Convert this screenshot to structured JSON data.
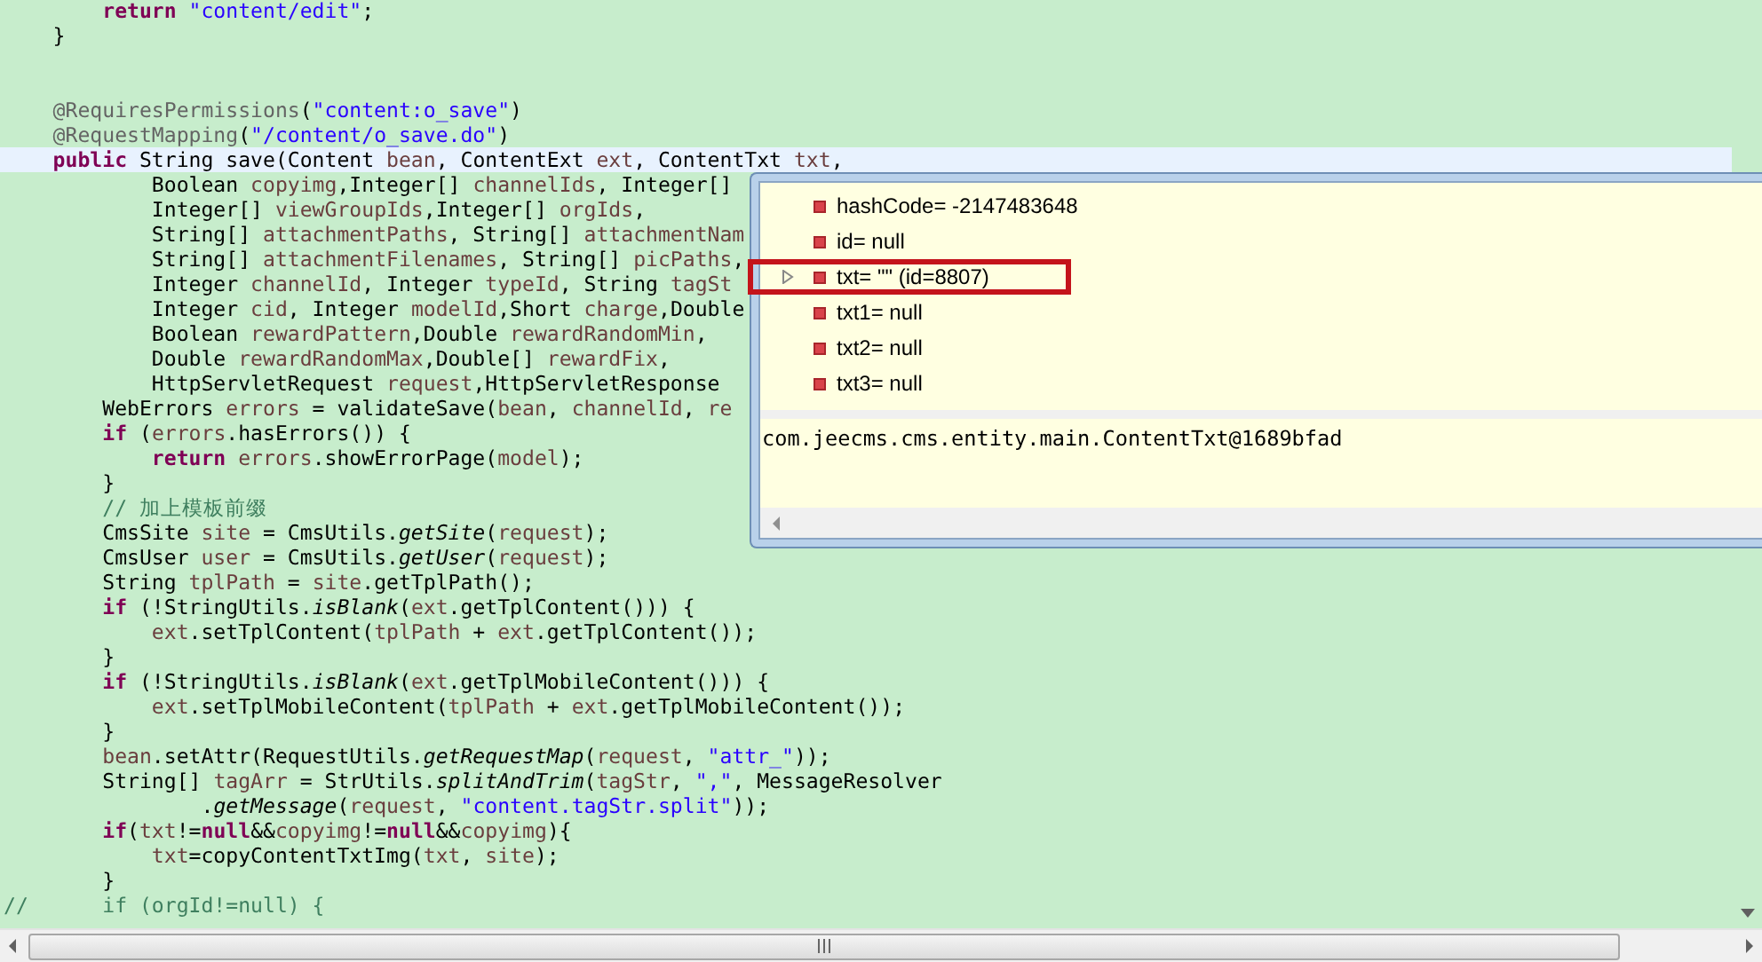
{
  "editor": {
    "lines": [
      {
        "kind": "code",
        "highlighted": false,
        "segments": [
          {
            "kind": "keyword",
            "text": "        return"
          },
          {
            "kind": "string",
            "text": " \"content/edit\""
          },
          {
            "kind": "plain",
            "text": ";"
          }
        ]
      },
      {
        "kind": "code",
        "highlighted": false,
        "segments": [
          {
            "kind": "plain",
            "text": "    }"
          }
        ]
      },
      {
        "kind": "blank",
        "highlighted": false
      },
      {
        "kind": "blank",
        "highlighted": false
      },
      {
        "kind": "code",
        "highlighted": false,
        "segments": [
          {
            "kind": "annotation",
            "text": "    @RequiresPermissions"
          },
          {
            "kind": "plain",
            "text": "("
          },
          {
            "kind": "string",
            "text": "\"content:o_save\""
          },
          {
            "kind": "plain",
            "text": ")"
          }
        ]
      },
      {
        "kind": "code",
        "highlighted": false,
        "segments": [
          {
            "kind": "annotation",
            "text": "    @RequestMapping"
          },
          {
            "kind": "plain",
            "text": "("
          },
          {
            "kind": "string",
            "text": "\"/content/o_save.do\""
          },
          {
            "kind": "plain",
            "text": ")"
          }
        ]
      },
      {
        "kind": "code",
        "highlighted": true,
        "segments": [
          {
            "kind": "keyword",
            "text": "    public"
          },
          {
            "kind": "plain",
            "text": " String save(Content "
          },
          {
            "kind": "variable",
            "text": "bean"
          },
          {
            "kind": "plain",
            "text": ", ContentExt "
          },
          {
            "kind": "variable",
            "text": "ext"
          },
          {
            "kind": "plain",
            "text": ", ContentTxt "
          },
          {
            "kind": "variable",
            "text": "txt"
          },
          {
            "kind": "plain",
            "text": ","
          }
        ]
      },
      {
        "kind": "code",
        "highlighted": false,
        "segments": [
          {
            "kind": "plain",
            "text": "            Boolean "
          },
          {
            "kind": "variable",
            "text": "copyimg"
          },
          {
            "kind": "plain",
            "text": ",Integer[] "
          },
          {
            "kind": "variable",
            "text": "channelIds"
          },
          {
            "kind": "plain",
            "text": ", Integer[]"
          }
        ]
      },
      {
        "kind": "code",
        "highlighted": false,
        "segments": [
          {
            "kind": "plain",
            "text": "            Integer[] "
          },
          {
            "kind": "variable",
            "text": "viewGroupIds"
          },
          {
            "kind": "plain",
            "text": ",Integer[] "
          },
          {
            "kind": "variable",
            "text": "orgIds"
          },
          {
            "kind": "plain",
            "text": ","
          }
        ]
      },
      {
        "kind": "code",
        "highlighted": false,
        "segments": [
          {
            "kind": "plain",
            "text": "            String[] "
          },
          {
            "kind": "variable",
            "text": "attachmentPaths"
          },
          {
            "kind": "plain",
            "text": ", String[] "
          },
          {
            "kind": "variable",
            "text": "attachmentNam"
          }
        ]
      },
      {
        "kind": "code",
        "highlighted": false,
        "segments": [
          {
            "kind": "plain",
            "text": "            String[] "
          },
          {
            "kind": "variable",
            "text": "attachmentFilenames"
          },
          {
            "kind": "plain",
            "text": ", String[] "
          },
          {
            "kind": "variable",
            "text": "picPaths"
          },
          {
            "kind": "plain",
            "text": ","
          }
        ]
      },
      {
        "kind": "code",
        "highlighted": false,
        "segments": [
          {
            "kind": "plain",
            "text": "            Integer "
          },
          {
            "kind": "variable",
            "text": "channelId"
          },
          {
            "kind": "plain",
            "text": ", Integer "
          },
          {
            "kind": "variable",
            "text": "typeId"
          },
          {
            "kind": "plain",
            "text": ", String "
          },
          {
            "kind": "variable",
            "text": "tagSt"
          }
        ]
      },
      {
        "kind": "code",
        "highlighted": false,
        "segments": [
          {
            "kind": "plain",
            "text": "            Integer "
          },
          {
            "kind": "variable",
            "text": "cid"
          },
          {
            "kind": "plain",
            "text": ", Integer "
          },
          {
            "kind": "variable",
            "text": "modelId"
          },
          {
            "kind": "plain",
            "text": ",Short "
          },
          {
            "kind": "variable",
            "text": "charge"
          },
          {
            "kind": "plain",
            "text": ",Double"
          }
        ]
      },
      {
        "kind": "code",
        "highlighted": false,
        "segments": [
          {
            "kind": "plain",
            "text": "            Boolean "
          },
          {
            "kind": "variable",
            "text": "rewardPattern"
          },
          {
            "kind": "plain",
            "text": ",Double "
          },
          {
            "kind": "variable",
            "text": "rewardRandomMin"
          },
          {
            "kind": "plain",
            "text": ","
          }
        ]
      },
      {
        "kind": "code",
        "highlighted": false,
        "segments": [
          {
            "kind": "plain",
            "text": "            Double "
          },
          {
            "kind": "variable",
            "text": "rewardRandomMax"
          },
          {
            "kind": "plain",
            "text": ",Double[] "
          },
          {
            "kind": "variable",
            "text": "rewardFix"
          },
          {
            "kind": "plain",
            "text": ","
          }
        ]
      },
      {
        "kind": "code",
        "highlighted": false,
        "segments": [
          {
            "kind": "plain",
            "text": "            HttpServletRequest "
          },
          {
            "kind": "variable",
            "text": "request"
          },
          {
            "kind": "plain",
            "text": ",HttpServletResponse"
          }
        ]
      },
      {
        "kind": "code",
        "highlighted": false,
        "segments": [
          {
            "kind": "plain",
            "text": "        WebErrors "
          },
          {
            "kind": "variable",
            "text": "errors"
          },
          {
            "kind": "plain",
            "text": " = validateSave("
          },
          {
            "kind": "variable",
            "text": "bean"
          },
          {
            "kind": "plain",
            "text": ", "
          },
          {
            "kind": "variable",
            "text": "channelId"
          },
          {
            "kind": "plain",
            "text": ", "
          },
          {
            "kind": "variable",
            "text": "re"
          }
        ]
      },
      {
        "kind": "code",
        "highlighted": false,
        "segments": [
          {
            "kind": "keyword",
            "text": "        if"
          },
          {
            "kind": "plain",
            "text": " ("
          },
          {
            "kind": "variable",
            "text": "errors"
          },
          {
            "kind": "plain",
            "text": ".hasErrors()) {"
          }
        ]
      },
      {
        "kind": "code",
        "highlighted": false,
        "segments": [
          {
            "kind": "keyword",
            "text": "            return"
          },
          {
            "kind": "variable",
            "text": " errors"
          },
          {
            "kind": "plain",
            "text": ".showErrorPage("
          },
          {
            "kind": "variable",
            "text": "model"
          },
          {
            "kind": "plain",
            "text": ");"
          }
        ]
      },
      {
        "kind": "code",
        "highlighted": false,
        "segments": [
          {
            "kind": "plain",
            "text": "        }"
          }
        ]
      },
      {
        "kind": "code",
        "highlighted": false,
        "segments": [
          {
            "kind": "comment",
            "text": "        // 加上模板前缀"
          }
        ]
      },
      {
        "kind": "code",
        "highlighted": false,
        "segments": [
          {
            "kind": "plain",
            "text": "        CmsSite "
          },
          {
            "kind": "variable",
            "text": "site"
          },
          {
            "kind": "plain",
            "text": " = CmsUtils."
          },
          {
            "kind": "static",
            "text": "getSite"
          },
          {
            "kind": "plain",
            "text": "("
          },
          {
            "kind": "variable",
            "text": "request"
          },
          {
            "kind": "plain",
            "text": ");"
          }
        ]
      },
      {
        "kind": "code",
        "highlighted": false,
        "segments": [
          {
            "kind": "plain",
            "text": "        CmsUser "
          },
          {
            "kind": "variable",
            "text": "user"
          },
          {
            "kind": "plain",
            "text": " = CmsUtils."
          },
          {
            "kind": "static",
            "text": "getUser"
          },
          {
            "kind": "plain",
            "text": "("
          },
          {
            "kind": "variable",
            "text": "request"
          },
          {
            "kind": "plain",
            "text": ");"
          }
        ]
      },
      {
        "kind": "code",
        "highlighted": false,
        "segments": [
          {
            "kind": "plain",
            "text": "        String "
          },
          {
            "kind": "variable",
            "text": "tplPath"
          },
          {
            "kind": "plain",
            "text": " = "
          },
          {
            "kind": "variable",
            "text": "site"
          },
          {
            "kind": "plain",
            "text": ".getTplPath();"
          }
        ]
      },
      {
        "kind": "code",
        "highlighted": false,
        "segments": [
          {
            "kind": "keyword",
            "text": "        if"
          },
          {
            "kind": "plain",
            "text": " (!StringUtils."
          },
          {
            "kind": "static",
            "text": "isBlank"
          },
          {
            "kind": "plain",
            "text": "("
          },
          {
            "kind": "variable",
            "text": "ext"
          },
          {
            "kind": "plain",
            "text": ".getTplContent())) {"
          }
        ]
      },
      {
        "kind": "code",
        "highlighted": false,
        "segments": [
          {
            "kind": "variable",
            "text": "            ext"
          },
          {
            "kind": "plain",
            "text": ".setTplContent("
          },
          {
            "kind": "variable",
            "text": "tplPath"
          },
          {
            "kind": "plain",
            "text": " + "
          },
          {
            "kind": "variable",
            "text": "ext"
          },
          {
            "kind": "plain",
            "text": ".getTplContent());"
          }
        ]
      },
      {
        "kind": "code",
        "highlighted": false,
        "segments": [
          {
            "kind": "plain",
            "text": "        }"
          }
        ]
      },
      {
        "kind": "code",
        "highlighted": false,
        "segments": [
          {
            "kind": "keyword",
            "text": "        if"
          },
          {
            "kind": "plain",
            "text": " (!StringUtils."
          },
          {
            "kind": "static",
            "text": "isBlank"
          },
          {
            "kind": "plain",
            "text": "("
          },
          {
            "kind": "variable",
            "text": "ext"
          },
          {
            "kind": "plain",
            "text": ".getTplMobileContent())) {"
          }
        ]
      },
      {
        "kind": "code",
        "highlighted": false,
        "segments": [
          {
            "kind": "variable",
            "text": "            ext"
          },
          {
            "kind": "plain",
            "text": ".setTplMobileContent("
          },
          {
            "kind": "variable",
            "text": "tplPath"
          },
          {
            "kind": "plain",
            "text": " + "
          },
          {
            "kind": "variable",
            "text": "ext"
          },
          {
            "kind": "plain",
            "text": ".getTplMobileContent());"
          }
        ]
      },
      {
        "kind": "code",
        "highlighted": false,
        "segments": [
          {
            "kind": "plain",
            "text": "        }"
          }
        ]
      },
      {
        "kind": "code",
        "highlighted": false,
        "segments": [
          {
            "kind": "variable",
            "text": "        bean"
          },
          {
            "kind": "plain",
            "text": ".setAttr(RequestUtils."
          },
          {
            "kind": "static",
            "text": "getRequestMap"
          },
          {
            "kind": "plain",
            "text": "("
          },
          {
            "kind": "variable",
            "text": "request"
          },
          {
            "kind": "plain",
            "text": ", "
          },
          {
            "kind": "string",
            "text": "\"attr_\""
          },
          {
            "kind": "plain",
            "text": "));"
          }
        ]
      },
      {
        "kind": "code",
        "highlighted": false,
        "segments": [
          {
            "kind": "plain",
            "text": "        String[] "
          },
          {
            "kind": "variable",
            "text": "tagArr"
          },
          {
            "kind": "plain",
            "text": " = StrUtils."
          },
          {
            "kind": "static",
            "text": "splitAndTrim"
          },
          {
            "kind": "plain",
            "text": "("
          },
          {
            "kind": "variable",
            "text": "tagStr"
          },
          {
            "kind": "plain",
            "text": ", "
          },
          {
            "kind": "string",
            "text": "\",\""
          },
          {
            "kind": "plain",
            "text": ", MessageResolver"
          }
        ]
      },
      {
        "kind": "code",
        "highlighted": false,
        "segments": [
          {
            "kind": "plain",
            "text": "                ."
          },
          {
            "kind": "static",
            "text": "getMessage"
          },
          {
            "kind": "plain",
            "text": "("
          },
          {
            "kind": "variable",
            "text": "request"
          },
          {
            "kind": "plain",
            "text": ", "
          },
          {
            "kind": "string",
            "text": "\"content.tagStr.split\""
          },
          {
            "kind": "plain",
            "text": "));"
          }
        ]
      },
      {
        "kind": "code",
        "highlighted": false,
        "segments": [
          {
            "kind": "keyword",
            "text": "        if"
          },
          {
            "kind": "plain",
            "text": "("
          },
          {
            "kind": "variable",
            "text": "txt"
          },
          {
            "kind": "plain",
            "text": "!="
          },
          {
            "kind": "keyword",
            "text": "null"
          },
          {
            "kind": "plain",
            "text": "&&"
          },
          {
            "kind": "variable",
            "text": "copyimg"
          },
          {
            "kind": "plain",
            "text": "!="
          },
          {
            "kind": "keyword",
            "text": "null"
          },
          {
            "kind": "plain",
            "text": "&&"
          },
          {
            "kind": "variable",
            "text": "copyimg"
          },
          {
            "kind": "plain",
            "text": "){"
          }
        ]
      },
      {
        "kind": "code",
        "highlighted": false,
        "segments": [
          {
            "kind": "variable",
            "text": "            txt"
          },
          {
            "kind": "plain",
            "text": "=copyContentTxtImg("
          },
          {
            "kind": "variable",
            "text": "txt"
          },
          {
            "kind": "plain",
            "text": ", "
          },
          {
            "kind": "variable",
            "text": "site"
          },
          {
            "kind": "plain",
            "text": ");"
          }
        ]
      },
      {
        "kind": "code",
        "highlighted": false,
        "segments": [
          {
            "kind": "plain",
            "text": "        }"
          }
        ]
      },
      {
        "kind": "code",
        "highlighted": false,
        "segments": [
          {
            "kind": "comment",
            "text": "//      if (orgId!=null) {"
          }
        ]
      }
    ]
  },
  "inspector": {
    "variables": [
      {
        "label": "hashCode= -2147483648",
        "expandable": false,
        "boxed": false
      },
      {
        "label": "id= null",
        "expandable": false,
        "boxed": false
      },
      {
        "label": "txt= \"\" (id=8807)",
        "expandable": true,
        "boxed": true
      },
      {
        "label": "txt1= null",
        "expandable": false,
        "boxed": false
      },
      {
        "label": "txt2= null",
        "expandable": false,
        "boxed": false
      },
      {
        "label": "txt3= null",
        "expandable": false,
        "boxed": false
      }
    ],
    "detail": "com.jeecms.cms.entity.main.ContentTxt@1689bfad"
  }
}
